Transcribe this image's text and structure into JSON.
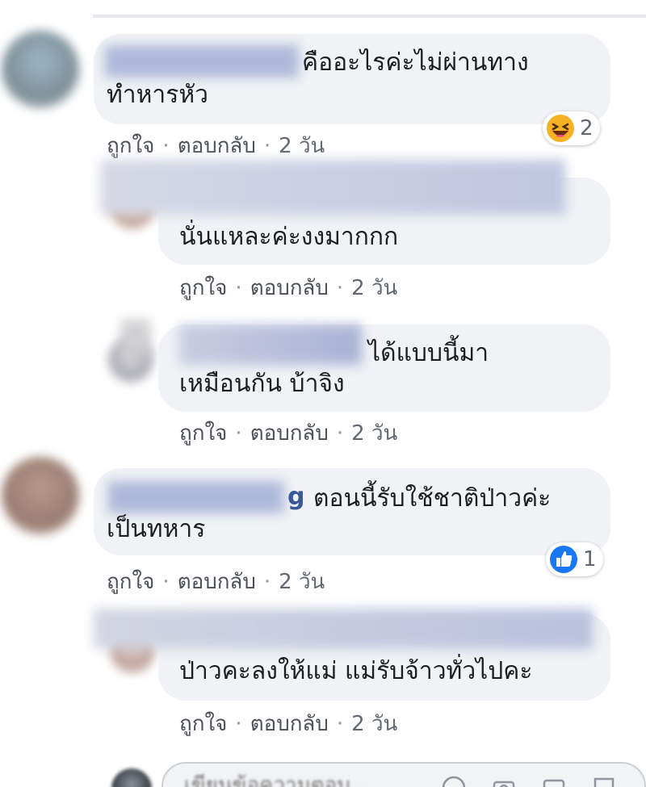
{
  "comments": [
    {
      "id": "c1",
      "text_line1": "คืออะไรค่ะไม่ผ่านทาง",
      "text_line2": "ทำหารหัว",
      "reaction": {
        "icon": "haha-emoji-icon",
        "count": "2"
      },
      "actions": {
        "like": "ถูกใจ",
        "reply": "ตอบกลับ",
        "time": "2 วัน"
      }
    },
    {
      "id": "c2",
      "text_line1": "นั่นแหละค่ะงงมากกก",
      "actions": {
        "like": "ถูกใจ",
        "reply": "ตอบกลับ",
        "time": "2 วัน"
      }
    },
    {
      "id": "c3",
      "text_line1": "ได้แบบนี้มา",
      "text_line2": "เหมือนกัน บ้าจิง",
      "actions": {
        "like": "ถูกใจ",
        "reply": "ตอบกลับ",
        "time": "2 วัน"
      }
    },
    {
      "id": "c4",
      "name_tail": "g",
      "text_line1": "ตอนนี้รับใช้ชาติป่าวค่ะ",
      "text_line2": "เป็นทหาร",
      "reaction": {
        "icon": "like-thumb-icon",
        "count": "1"
      },
      "actions": {
        "like": "ถูกใจ",
        "reply": "ตอบกลับ",
        "time": "2 วัน"
      }
    },
    {
      "id": "c5",
      "text_line1": "ป่าวคะลงให้แม่ แม่รับจ้าวทั่วไปคะ",
      "actions": {
        "like": "ถูกใจ",
        "reply": "ตอบกลับ",
        "time": "2 วัน"
      }
    }
  ],
  "composer": {
    "placeholder": "เขียนข้อความตอบ..."
  },
  "colors": {
    "bubble": "#f0f2f5",
    "name": "#385898",
    "like_blue": "#1877f2",
    "haha_yellow": "#f7b125"
  }
}
